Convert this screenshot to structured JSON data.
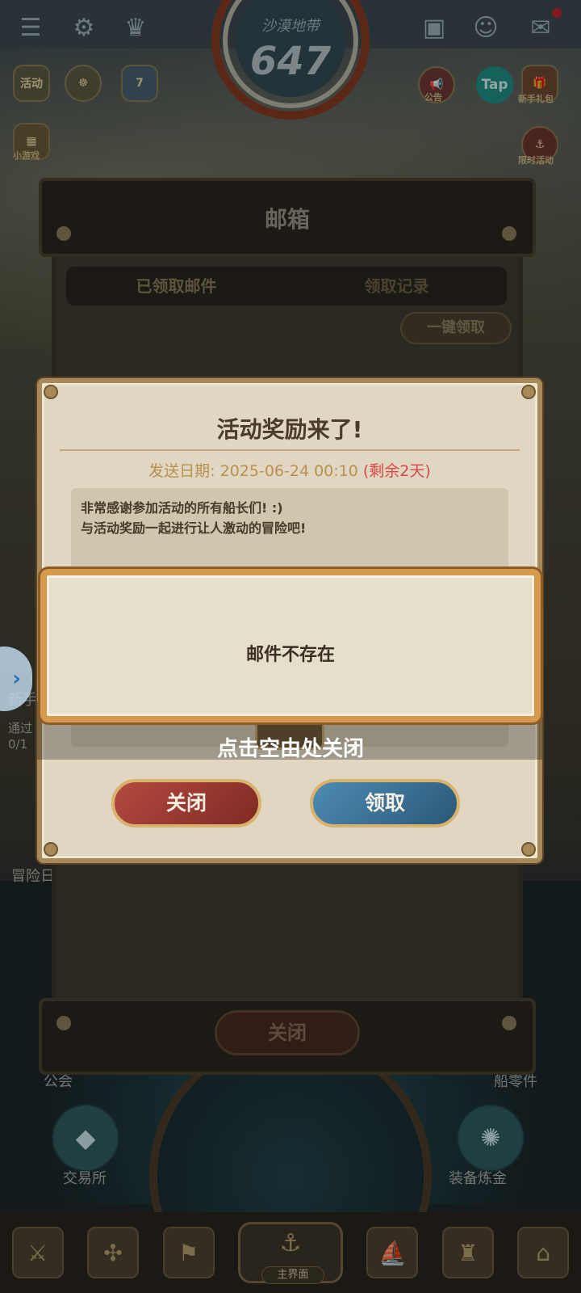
{
  "hud": {
    "zone_name": "沙漠地带",
    "level": "647",
    "icons": [
      {
        "name": "menu-icon",
        "glyph": "☰"
      },
      {
        "name": "gear-icon",
        "glyph": "⚙"
      },
      {
        "name": "trophy-icon",
        "glyph": "🏆"
      },
      {
        "name": "briefcase-icon",
        "glyph": "💼"
      },
      {
        "name": "friends-icon",
        "glyph": "👥"
      },
      {
        "name": "mail-icon",
        "glyph": "✉"
      }
    ],
    "event_icon_label": "活动",
    "calendar_day": "7",
    "notice_label": "公告",
    "tap_label": "Tap",
    "gift_label": "新手礼包",
    "minigame_label": "小游戏",
    "limited_label": "限时活动"
  },
  "background": {
    "guild_label": "公会",
    "trade_label": "交易所",
    "smelt_label": "装备炼金",
    "parts_label": "船零件",
    "adventure_label": "冒险日",
    "newbie_label": "新手",
    "pass_label": "通过",
    "progress_label": "0/1"
  },
  "mailbox": {
    "title": "邮箱",
    "tabs": [
      {
        "label": "已领取邮件"
      },
      {
        "label": "领取记录"
      }
    ],
    "claim_all_label": "一键领取",
    "close_label": "关闭"
  },
  "dialog": {
    "title": "活动奖励来了!",
    "date_label": "发送日期:",
    "date_value": "2025-06-24 00:10",
    "remaining": "(剩余2天)",
    "body_lines": [
      "非常感谢参加活动的所有船长们! :)",
      "与活动奖励一起进行让人激动的冒险吧!"
    ],
    "close_label": "关闭",
    "claim_label": "领取"
  },
  "toast": {
    "message": "邮件不存在"
  },
  "hint": "点击空由处关闭",
  "nav": {
    "home_label": "主界面"
  },
  "colors": {
    "accent_gold": "#d79a4c",
    "remaining_red": "#d8474a",
    "close_red": "#b44a40",
    "claim_blue": "#4e8bb4"
  }
}
